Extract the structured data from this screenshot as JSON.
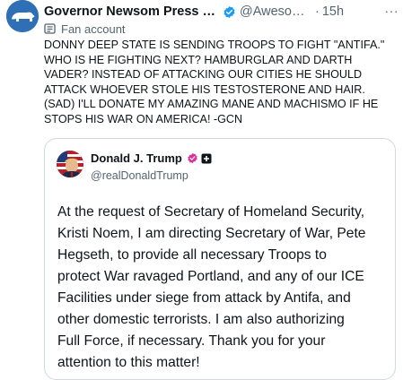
{
  "tweet": {
    "display_name": "Governor Newsom Press Offi...",
    "handle": "@Awesome...",
    "separator": "·",
    "time": "15h",
    "more_label": "···",
    "label_text": "Fan account",
    "body": "DONNY DEEP STATE IS SENDING TROOPS TO FIGHT \"ANTIFA.\"\nWHO IS HE FIGHTING NEXT? HAMBURGLAR AND DARTH\nVADER? INSTEAD OF ATTACKING OUR CITIES HE SHOULD\nATTACK WHOEVER STOLE HIS TESTOSTERONE AND HAIR.\n(SAD) I'LL DONATE MY AMAZING MANE AND MACHISMO IF HE\nSTOPS HIS WAR ON AMERICA! -GCN"
  },
  "quoted": {
    "display_name": "Donald J. Trump",
    "handle": "@realDonaldTrump",
    "body": "At the request of Secretary of Homeland Security,\nKristi Noem, I am directing Secretary of War, Pete\nHegseth, to provide all necessary Troops to\nprotect War ravaged Portland, and any of our ICE\nFacilities under siege from attack by Antifa, and\nother domestic terrorists. I am also authorizing\nFull Force, if necessary. Thank you for your\nattention to this matter!"
  },
  "colors": {
    "verified_blue": "#1d9bf0",
    "secondary_text": "#536471",
    "badge_pink": "#d9339a"
  }
}
